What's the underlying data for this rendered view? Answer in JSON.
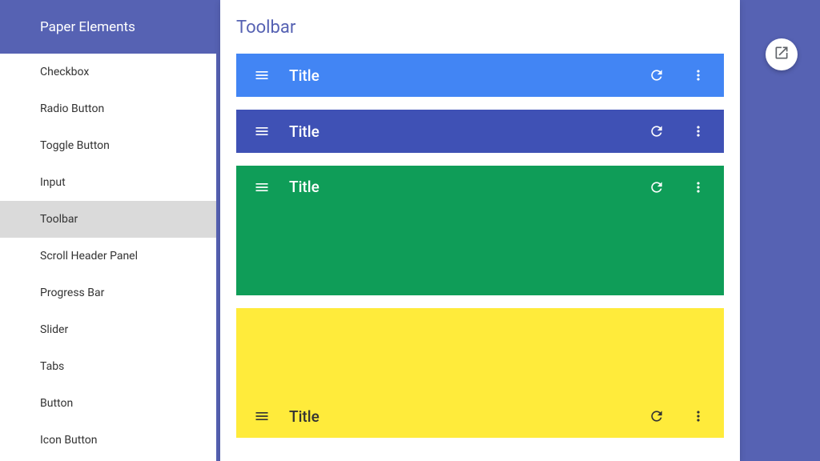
{
  "sidebar": {
    "header": "Paper Elements",
    "items": [
      {
        "label": "Checkbox",
        "active": false
      },
      {
        "label": "Radio Button",
        "active": false
      },
      {
        "label": "Toggle Button",
        "active": false
      },
      {
        "label": "Input",
        "active": false
      },
      {
        "label": "Toolbar",
        "active": true
      },
      {
        "label": "Scroll Header Panel",
        "active": false
      },
      {
        "label": "Progress Bar",
        "active": false
      },
      {
        "label": "Slider",
        "active": false
      },
      {
        "label": "Tabs",
        "active": false
      },
      {
        "label": "Button",
        "active": false
      },
      {
        "label": "Icon Button",
        "active": false
      }
    ]
  },
  "main": {
    "title": "Toolbar",
    "toolbars": [
      {
        "title": "Title",
        "color": "blue"
      },
      {
        "title": "Title",
        "color": "indigo"
      },
      {
        "title": "Title",
        "color": "green"
      },
      {
        "title": "Title",
        "color": "yellow"
      }
    ]
  }
}
